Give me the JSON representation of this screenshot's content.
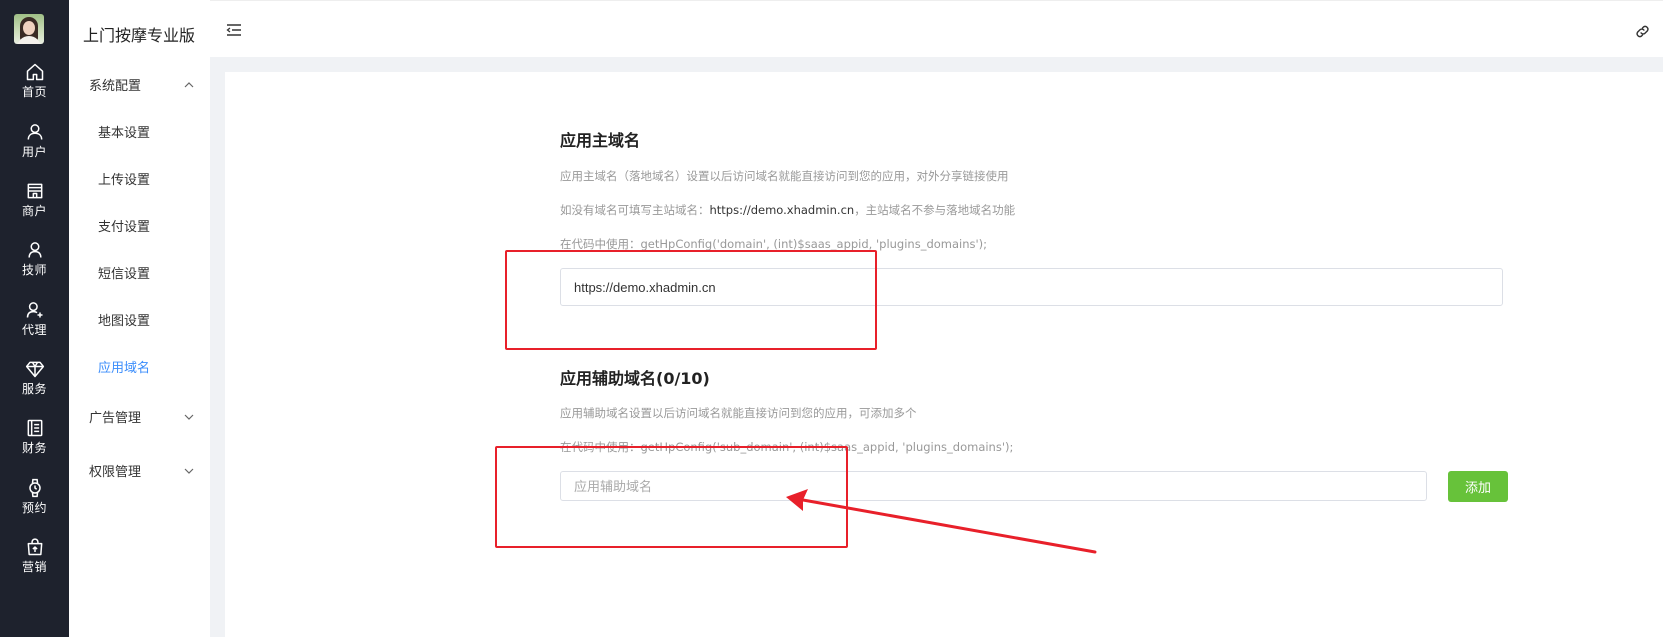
{
  "app": {
    "title": "上门按摩专业版"
  },
  "rail": {
    "items": [
      {
        "label": "首页",
        "icon": "home-icon"
      },
      {
        "label": "用户",
        "icon": "user-icon"
      },
      {
        "label": "商户",
        "icon": "store-icon"
      },
      {
        "label": "技师",
        "icon": "person-icon"
      },
      {
        "label": "代理",
        "icon": "user-plus-icon"
      },
      {
        "label": "服务",
        "icon": "diamond-icon"
      },
      {
        "label": "财务",
        "icon": "ledger-icon"
      },
      {
        "label": "预约",
        "icon": "watch-icon"
      },
      {
        "label": "营销",
        "icon": "shopping-bag-icon"
      }
    ]
  },
  "submenu": {
    "groups": [
      {
        "label": "系统配置",
        "expanded": true,
        "items": [
          "基本设置",
          "上传设置",
          "支付设置",
          "短信设置",
          "地图设置",
          "应用域名"
        ],
        "active": "应用域名"
      },
      {
        "label": "广告管理",
        "expanded": false
      },
      {
        "label": "权限管理",
        "expanded": false
      }
    ]
  },
  "main": {
    "primary": {
      "title": "应用主域名",
      "desc1": "应用主域名（落地域名）设置以后访问域名就能直接访问到您的应用，对外分享链接使用",
      "desc2_prefix": "如没有域名可填写主站域名：",
      "desc2_link": "https://demo.xhadmin.cn",
      "desc2_suffix": "，主站域名不参与落地域名功能",
      "desc3": "在代码中使用：getHpConfig('domain', (int)$saas_appid, 'plugins_domains');",
      "value": "https://demo.xhadmin.cn"
    },
    "secondary": {
      "title": "应用辅助域名(0/10)",
      "desc1": "应用辅助域名设置以后访问域名就能直接访问到您的应用，可添加多个",
      "desc2": "在代码中使用：getHpConfig('sub_domain', (int)$saas_appid, 'plugins_domains');",
      "placeholder": "应用辅助域名",
      "add_label": "添加"
    }
  },
  "colors": {
    "rail_bg": "#1e222d",
    "active_menu": "#3b8dfb",
    "add_button": "#67c23a",
    "annotation": "#e8202a"
  }
}
